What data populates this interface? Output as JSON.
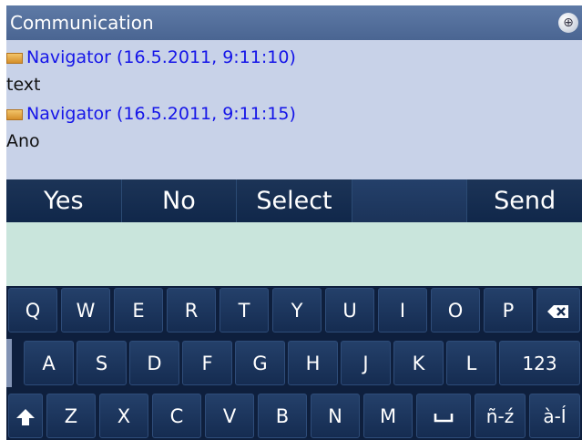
{
  "title": "Communication",
  "icons": {
    "globe": "globe-icon",
    "message": "message-icon",
    "backspace": "backspace-icon",
    "shift": "shift-icon",
    "space": "space-icon"
  },
  "messages": [
    {
      "sender": "Navigator (16.5.2011, 9:11:10)",
      "text": "text"
    },
    {
      "sender": "Navigator (16.5.2011, 9:11:15)",
      "text": "Ano"
    }
  ],
  "quick_buttons": [
    "Yes",
    "No",
    "Select",
    "",
    "Send"
  ],
  "input_value": "",
  "keyboard": {
    "row1": [
      "Q",
      "W",
      "E",
      "R",
      "T",
      "Y",
      "U",
      "I",
      "O",
      "P"
    ],
    "row2": [
      "A",
      "S",
      "D",
      "F",
      "G",
      "H",
      "J",
      "K",
      "L"
    ],
    "row2_numbers": "123",
    "row3": [
      "Z",
      "X",
      "C",
      "V",
      "B",
      "N",
      "M"
    ],
    "lang1": "ñ-ź",
    "lang2": "à-Í"
  },
  "colors": {
    "title_bar": "#4f6b97",
    "messages_bg": "#c8d2e8",
    "sender_text": "#1515e8",
    "input_bg": "#c9e5dc",
    "keyboard_bg": "#0e1f3d"
  }
}
